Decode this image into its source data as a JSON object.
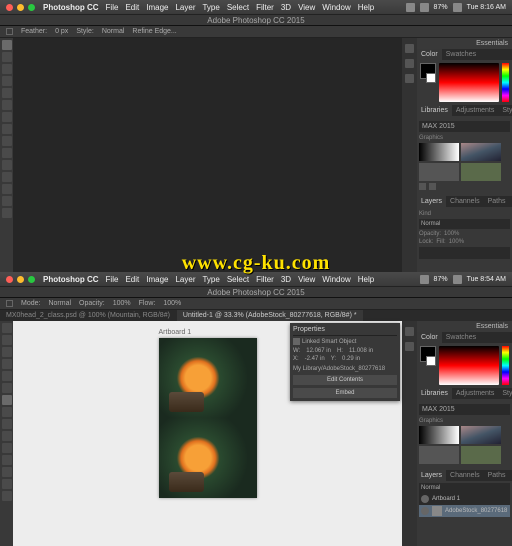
{
  "watermark": "www.cg-ku.com",
  "top": {
    "menubar": {
      "app": "Photoshop CC",
      "items": [
        "File",
        "Edit",
        "Image",
        "Layer",
        "Type",
        "Select",
        "Filter",
        "3D",
        "View",
        "Window",
        "Help"
      ],
      "battery": "87%",
      "time": "Tue 8:16 AM"
    },
    "title": "Adobe Photoshop CC 2015",
    "options": {
      "feather_label": "Feather:",
      "feather_val": "0 px",
      "style_label": "Style:",
      "style_val": "Normal",
      "refine": "Refine Edge..."
    },
    "essentials": "Essentials",
    "panels": {
      "color_tab": "Color",
      "swatches_tab": "Swatches",
      "libraries_tab": "Libraries",
      "adjustments_tab": "Adjustments",
      "styles_tab": "Styles",
      "lib_selected": "MAX 2015",
      "lib_section": "Graphics",
      "layers_tab": "Layers",
      "channels_tab": "Channels",
      "paths_tab": "Paths",
      "kind": "Kind",
      "blend": "Normal",
      "opacity_label": "Opacity:",
      "opacity_val": "100%",
      "lock_label": "Lock:",
      "fill_label": "Fill:",
      "fill_val": "100%"
    }
  },
  "bottom": {
    "menubar": {
      "app": "Photoshop CC",
      "items": [
        "File",
        "Edit",
        "Image",
        "Layer",
        "Type",
        "Select",
        "Filter",
        "3D",
        "View",
        "Window",
        "Help"
      ],
      "battery": "87%",
      "time": "Tue 8:54 AM"
    },
    "title": "Adobe Photoshop CC 2015",
    "options": {
      "mode_label": "Mode:",
      "mode_val": "Normal",
      "opacity_label": "Opacity:",
      "opacity_val": "100%",
      "flow_label": "Flow:",
      "flow_val": "100%"
    },
    "tabs": {
      "tab1": "MX0head_2_class.psd @ 100% (Mountain, RGB/8#)",
      "tab2": "Untitled-1 @ 33.3% (AdobeStock_80277618, RGB/8#) *"
    },
    "artboard": {
      "label": "Artboard 1"
    },
    "properties": {
      "title": "Properties",
      "subtype": "Linked Smart Object",
      "w_label": "W:",
      "w_val": "12.067 in",
      "h_label": "H:",
      "h_val": "11.008 in",
      "x_label": "X:",
      "x_val": "-2.47 in",
      "y_label": "Y:",
      "y_val": "0.29 in",
      "path": "My Library/AdobeStock_80277618",
      "btn_edit": "Edit Contents",
      "btn_embed": "Embed"
    },
    "panels": {
      "lib_selected": "MAX 2015",
      "layers": {
        "artboard": "Artboard 1",
        "layer": "AdobeStock_80277618"
      }
    }
  }
}
